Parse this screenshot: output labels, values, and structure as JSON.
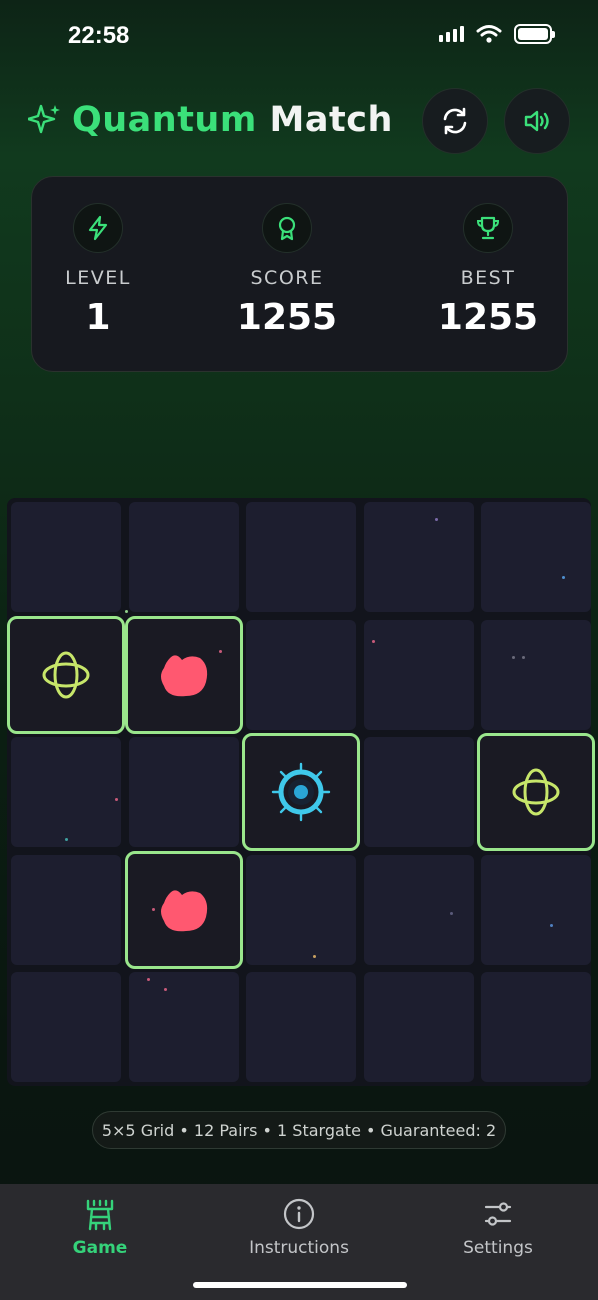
{
  "status_bar": {
    "time": "22:58"
  },
  "header": {
    "title_accent": "Quantum",
    "title_rest": "Match",
    "refresh_icon": "refresh-icon",
    "sound_icon": "volume-icon",
    "colors": {
      "accent": "#3be07a"
    }
  },
  "stats": [
    {
      "label": "LEVEL",
      "value": "1",
      "icon": "lightning-icon"
    },
    {
      "label": "SCORE",
      "value": "1255",
      "icon": "award-icon"
    },
    {
      "label": "BEST",
      "value": "1255",
      "icon": "trophy-icon"
    }
  ],
  "board": {
    "rows": 5,
    "cols": 5,
    "revealed": [
      {
        "row": 1,
        "col": 0,
        "symbol": "atom-icon"
      },
      {
        "row": 1,
        "col": 1,
        "symbol": "blob-icon"
      },
      {
        "row": 2,
        "col": 2,
        "symbol": "stargate-icon"
      },
      {
        "row": 2,
        "col": 4,
        "symbol": "atom-icon"
      },
      {
        "row": 3,
        "col": 1,
        "symbol": "blob-icon"
      }
    ]
  },
  "info": "5×5 Grid • 12 Pairs • 1 Stargate • Guaranteed: 2",
  "tabs": [
    {
      "label": "Game",
      "icon": "tower-icon",
      "active": true
    },
    {
      "label": "Instructions",
      "icon": "info-icon",
      "active": false
    },
    {
      "label": "Settings",
      "icon": "sliders-icon",
      "active": false
    }
  ]
}
